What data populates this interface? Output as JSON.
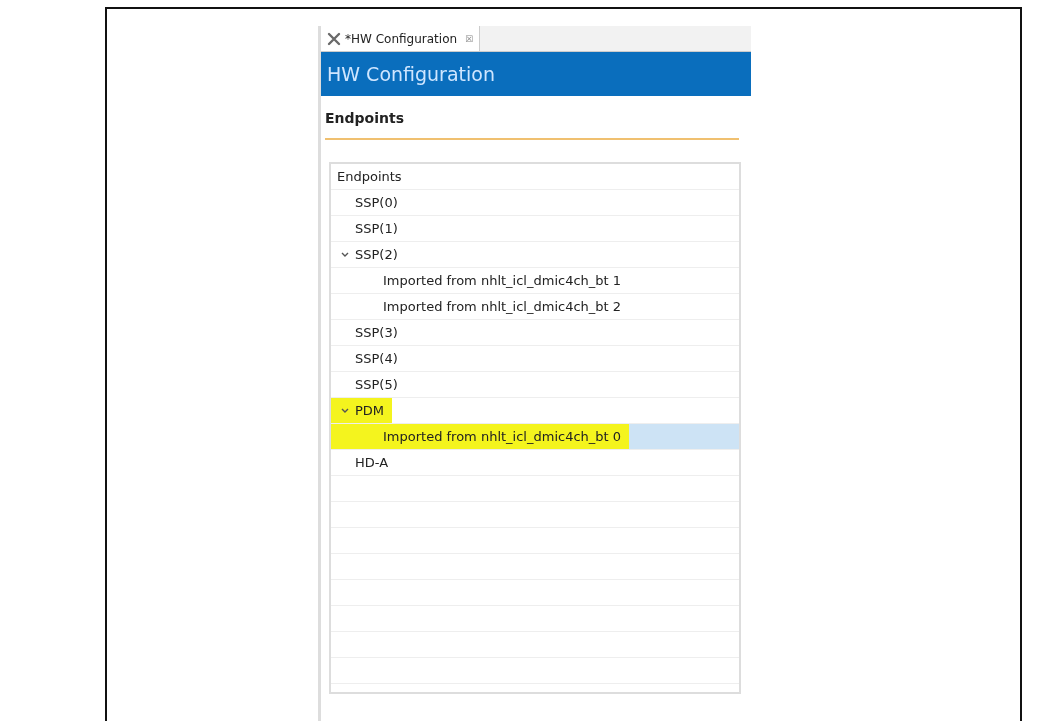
{
  "tab": {
    "title": "*HW Configuration",
    "close": "☒",
    "selected": true
  },
  "header": {
    "title": "HW Configuration"
  },
  "section": {
    "title": "Endpoints"
  },
  "tree": [
    {
      "label": "Endpoints",
      "selected": false,
      "highlighted": false,
      "children": [
        {
          "label": "SSP(0)",
          "selected": false,
          "highlighted": false
        },
        {
          "label": "SSP(1)",
          "selected": false,
          "highlighted": false
        },
        {
          "label": "SSP(2)",
          "expanded": true,
          "selected": false,
          "highlighted": false,
          "children": [
            {
              "label": "Imported from nhlt_icl_dmic4ch_bt 1",
              "selected": false,
              "highlighted": false
            },
            {
              "label": "Imported from nhlt_icl_dmic4ch_bt 2",
              "selected": false,
              "highlighted": false
            }
          ]
        },
        {
          "label": "SSP(3)",
          "selected": false,
          "highlighted": false
        },
        {
          "label": "SSP(4)",
          "selected": false,
          "highlighted": false
        },
        {
          "label": "SSP(5)",
          "selected": false,
          "highlighted": false
        },
        {
          "label": "PDM",
          "expanded": true,
          "selected": false,
          "highlighted": true,
          "children": [
            {
              "label": "Imported from nhlt_icl_dmic4ch_bt 0",
              "selected": true,
              "highlighted": true
            }
          ]
        },
        {
          "label": "HD-A",
          "selected": false,
          "highlighted": false
        }
      ]
    }
  ]
}
